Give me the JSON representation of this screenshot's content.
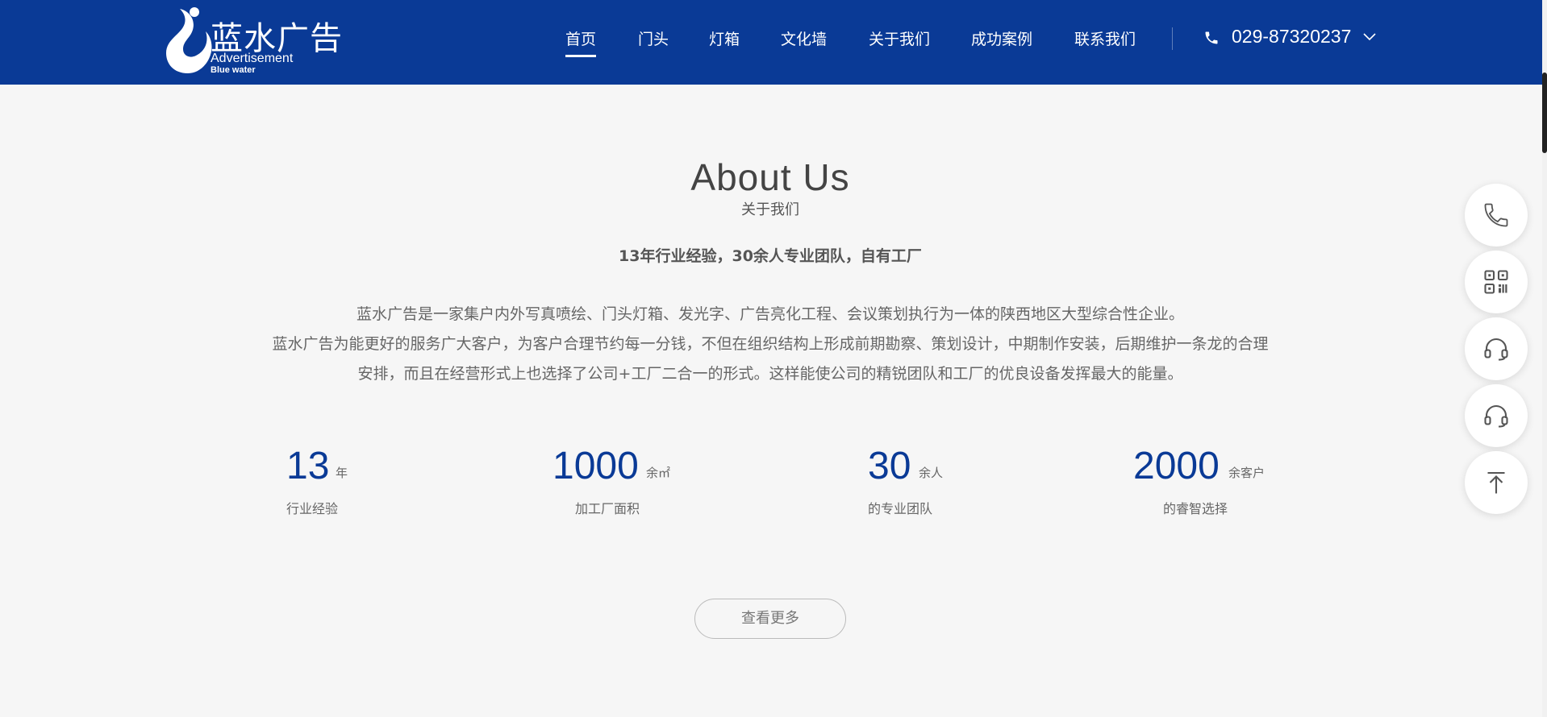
{
  "logo": {
    "name_cn": "蓝水广告",
    "name_en_line1": "Advertisement",
    "name_en_line2": "Blue water"
  },
  "nav": {
    "items": [
      {
        "label": "首页",
        "active": true
      },
      {
        "label": "门头",
        "active": false
      },
      {
        "label": "灯箱",
        "active": false
      },
      {
        "label": "文化墙",
        "active": false
      },
      {
        "label": "关于我们",
        "active": false
      },
      {
        "label": "成功案例",
        "active": false
      },
      {
        "label": "联系我们",
        "active": false
      }
    ],
    "phone": "029-87320237"
  },
  "about": {
    "title": "About Us",
    "subtitle": "关于我们",
    "tagline": "13年行业经验，30余人专业团队，自有工厂",
    "body_lines": [
      "蓝水广告是一家集户内外写真喷绘、门头灯箱、发光字、广告亮化工程、会议策划执行为一体的陕西地区大型综合性企业。",
      "蓝水广告为能更好的服务广大客户，为客户合理节约每一分钱，不但在组织结构上形成前期勘察、策划设计，中期制作安装，后期维护一条龙的合理安排，而且在经营形式上也选择了公司+工厂二合一的形式。这样能使公司的精锐团队和工厂的优良设备发挥最大的能量。"
    ],
    "stats": [
      {
        "number": "13",
        "unit": "年",
        "label": "行业经验"
      },
      {
        "number": "1000",
        "unit": "余㎡",
        "label": "加工厂面积"
      },
      {
        "number": "30",
        "unit": "余人",
        "label": "的专业团队"
      },
      {
        "number": "2000",
        "unit": "余客户",
        "label": "的睿智选择"
      }
    ],
    "more_label": "查看更多"
  },
  "side_tools": [
    "phone-icon",
    "qrcode-icon",
    "headset-icon",
    "headset-icon",
    "back-to-top-icon"
  ],
  "colors": {
    "brand_blue": "#0a3a96",
    "page_bg": "#f6f6f6"
  }
}
